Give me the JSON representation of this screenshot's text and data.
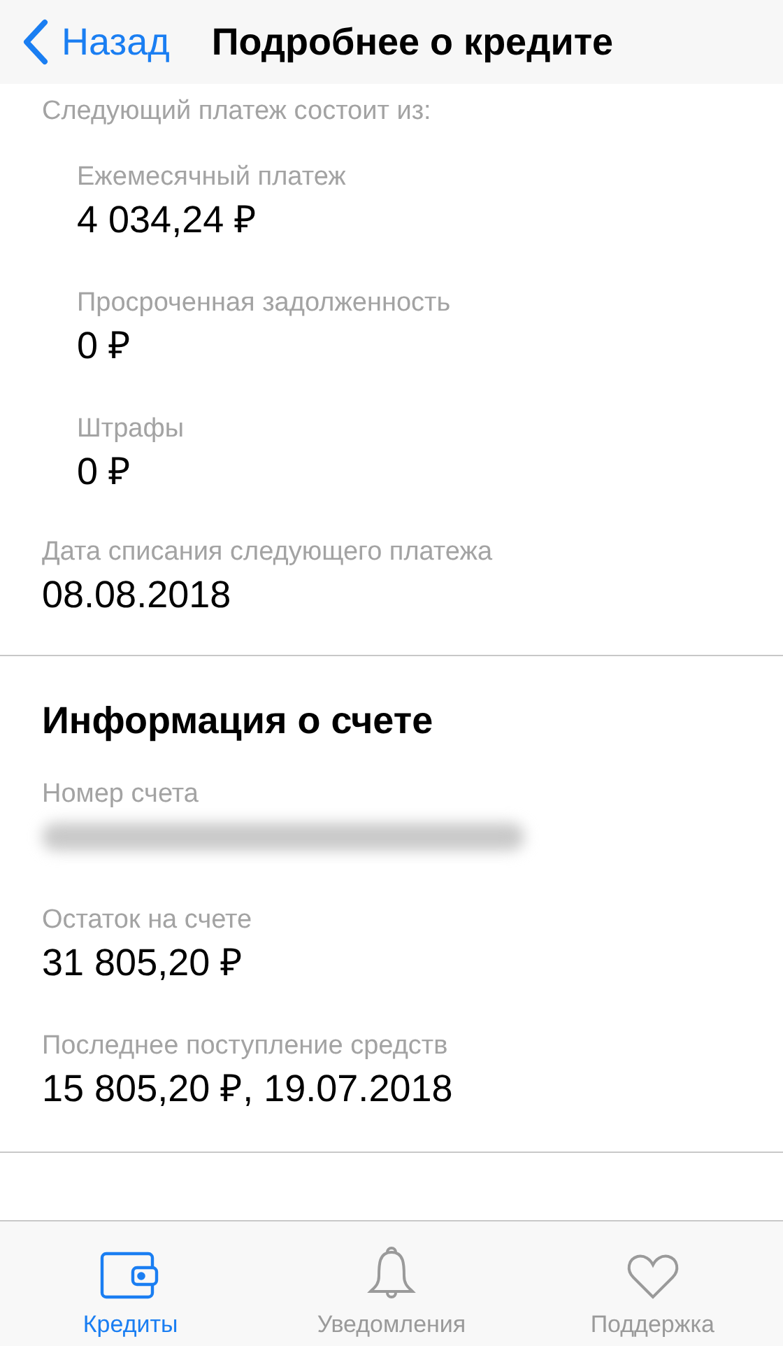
{
  "nav_bar": {
    "back_label": "Назад",
    "title": "Подробнее о кредите"
  },
  "next_payment": {
    "heading": "Следующий платеж состоит из:",
    "items": [
      {
        "label": "Ежемесячный платеж",
        "value": "4 034,24 ₽"
      },
      {
        "label": "Просроченная задолженность",
        "value": "0 ₽"
      },
      {
        "label": "Штрафы",
        "value": "0 ₽"
      }
    ],
    "date_label": "Дата списания следующего платежа",
    "date_value": "08.08.2018"
  },
  "account_info": {
    "heading": "Информация о счете",
    "fields": [
      {
        "label": "Номер счета",
        "kind": "redacted"
      },
      {
        "label": "Остаток на счете",
        "value": "31 805,20 ₽",
        "kind": "text"
      },
      {
        "label": "Последнее поступление средств",
        "value": "15 805,20 ₽, 19.07.2018",
        "kind": "text"
      }
    ]
  },
  "tab_bar": [
    {
      "label": "Кредиты",
      "kind": "wallet",
      "selected": true
    },
    {
      "label": "Уведомления",
      "kind": "bell",
      "selected": false
    },
    {
      "label": "Поддержка",
      "kind": "heart",
      "selected": false
    }
  ]
}
